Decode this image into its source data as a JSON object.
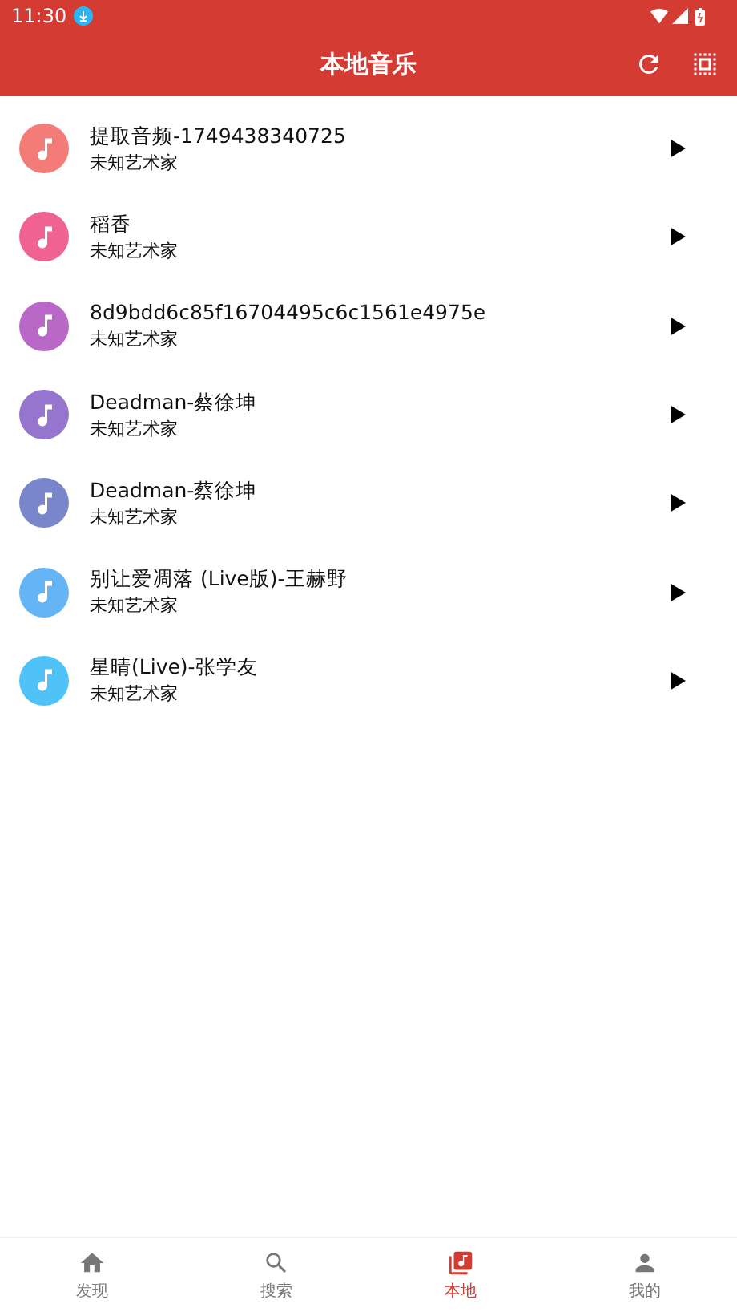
{
  "status_bar": {
    "time": "11:30"
  },
  "app_bar": {
    "title": "本地音乐"
  },
  "songs": [
    {
      "title": "提取音频-1749438340725",
      "artist": "未知艺术家",
      "color": "#f47c78"
    },
    {
      "title": "稻香",
      "artist": "未知艺术家",
      "color": "#f06292"
    },
    {
      "title": "8d9bdd6c85f16704495c6c1561e4975e",
      "artist": "未知艺术家",
      "color": "#ba68c8"
    },
    {
      "title": "Deadman-蔡徐坤",
      "artist": "未知艺术家",
      "color": "#9575cd"
    },
    {
      "title": "Deadman-蔡徐坤",
      "artist": "未知艺术家",
      "color": "#7986cb"
    },
    {
      "title": "别让爱凋落 (Live版)-王赫野",
      "artist": "未知艺术家",
      "color": "#64b5f6"
    },
    {
      "title": "星晴(Live)-张学友",
      "artist": "未知艺术家",
      "color": "#4fc3f7"
    }
  ],
  "bottom_nav": [
    {
      "label": "发现",
      "kind": "home",
      "selected": false
    },
    {
      "label": "搜索",
      "kind": "search",
      "selected": false
    },
    {
      "label": "本地",
      "kind": "library",
      "selected": true
    },
    {
      "label": "我的",
      "kind": "person",
      "selected": false
    }
  ]
}
